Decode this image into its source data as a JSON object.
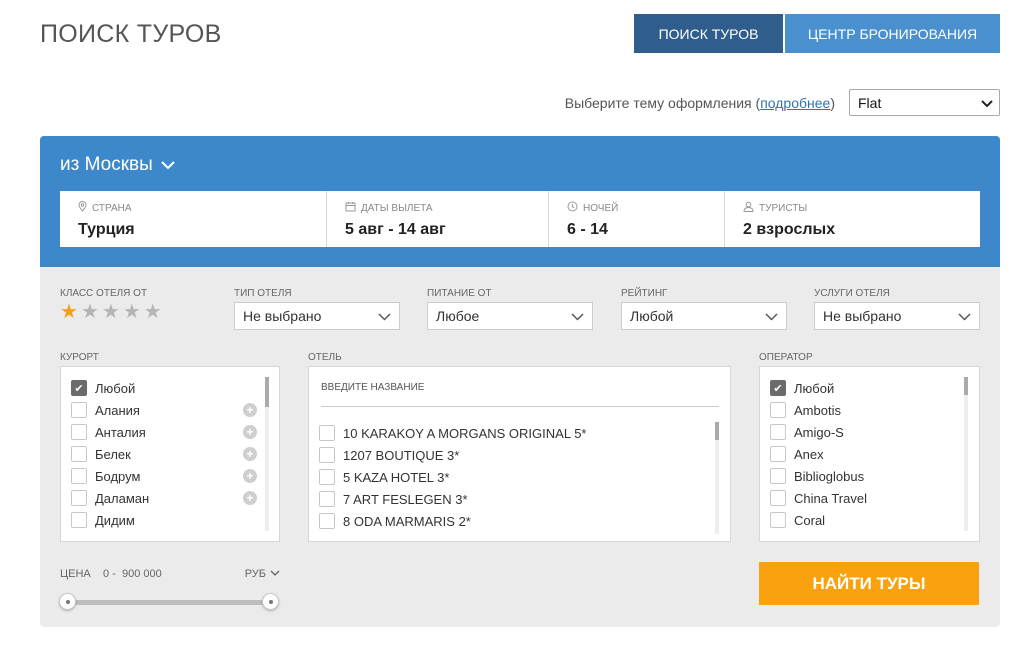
{
  "page": {
    "title": "ПОИСК ТУРОВ",
    "tabs": [
      {
        "label": "ПОИСК ТУРОВ",
        "active": true
      },
      {
        "label": "ЦЕНТР БРОНИРОВАНИЯ",
        "active": false
      }
    ]
  },
  "theme": {
    "label_prefix": "Выберите тему оформления (",
    "link": "подробнее",
    "label_suffix": ")",
    "selected": "Flat"
  },
  "search": {
    "departure": "из Москвы",
    "country": {
      "label": "СТРАНА",
      "value": "Турция"
    },
    "dates": {
      "label": "ДАТЫ ВЫЛЕТА",
      "value": "5 авг - 14 авг"
    },
    "nights": {
      "label": "НОЧЕЙ",
      "value": "6 - 14"
    },
    "tourists": {
      "label": "ТУРИСТЫ",
      "value": "2 взрослых"
    }
  },
  "filters": {
    "hotel_class": {
      "label": "КЛАСС ОТЕЛЯ ОТ",
      "rating": 1,
      "max": 5
    },
    "hotel_type": {
      "label": "ТИП ОТЕЛЯ",
      "value": "Не выбрано"
    },
    "meal": {
      "label": "ПИТАНИЕ ОТ",
      "value": "Любое"
    },
    "rating": {
      "label": "РЕЙТИНГ",
      "value": "Любой"
    },
    "services": {
      "label": "УСЛУГИ ОТЕЛЯ",
      "value": "Не выбрано"
    }
  },
  "resort": {
    "label": "КУРОРТ",
    "items": [
      {
        "label": "Любой",
        "checked": true
      },
      {
        "label": "Алания",
        "checked": false
      },
      {
        "label": "Анталия",
        "checked": false
      },
      {
        "label": "Белек",
        "checked": false
      },
      {
        "label": "Бодрум",
        "checked": false
      },
      {
        "label": "Даламан",
        "checked": false
      },
      {
        "label": "Дидим",
        "checked": false
      }
    ]
  },
  "hotel": {
    "label": "ОТЕЛЬ",
    "placeholder": "ВВЕДИТЕ НАЗВАНИЕ",
    "items": [
      {
        "label": "10 KARAKOY A MORGANS ORIGINAL 5*"
      },
      {
        "label": "1207 BOUTIQUE 3*"
      },
      {
        "label": "5 KAZA HOTEL 3*"
      },
      {
        "label": "7 ART FESLEGEN 3*"
      },
      {
        "label": "8 ODA MARMARIS 2*"
      }
    ]
  },
  "operator": {
    "label": "ОПЕРАТОР",
    "items": [
      {
        "label": "Любой",
        "checked": true
      },
      {
        "label": "Ambotis",
        "checked": false
      },
      {
        "label": "Amigo-S",
        "checked": false
      },
      {
        "label": "Anex",
        "checked": false
      },
      {
        "label": "Biblioglobus",
        "checked": false
      },
      {
        "label": "China Travel",
        "checked": false
      },
      {
        "label": "Coral",
        "checked": false
      }
    ]
  },
  "price": {
    "label": "ЦЕНА",
    "min": "0",
    "max": "900 000",
    "currency": "РУБ",
    "range_fraction": [
      0,
      1
    ]
  },
  "find_button": "НАЙТИ ТУРЫ",
  "colors": {
    "header_blue": "#3d88cb",
    "tab_active": "#2f5d8c",
    "tab_normal": "#4a90cf",
    "accent_orange": "#f9a10f",
    "star_on": "#f0a01c"
  }
}
